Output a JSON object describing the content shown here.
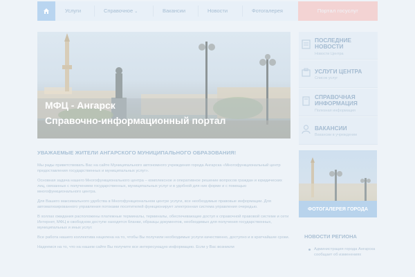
{
  "nav": {
    "items": [
      "Услуги",
      "Справочное",
      "Вакансии",
      "Новости",
      "Фотогалерея"
    ],
    "cta_label": "Портал госуслуг"
  },
  "hero": {
    "title": "МФЦ - Ангарск",
    "subtitle": "Справочно-информационный портал"
  },
  "sidebar": {
    "items": [
      {
        "title": "Последние новости",
        "sub": "Новости Центра"
      },
      {
        "title": "Услуги центра",
        "sub": "Список услуг"
      },
      {
        "title": "Справочная информация",
        "sub": "Полезная информация"
      },
      {
        "title": "Вакансии",
        "sub": "Вакансии в учреждении"
      }
    ],
    "gallery_caption": "ФОТОГАЛЕРЕЯ ГОРОДА",
    "news_title": "НОВОСТИ РЕГИОНА",
    "news_items": [
      "Администрация города Ангарска сообщает об изменениях"
    ]
  },
  "article": {
    "heading": "Уважаемые жители Ангарского муниципального образования!",
    "paragraphs": [
      "Мы рады приветствовать Вас на сайте Муниципального автономного учреждения города Ангарска «Многофункциональный центр предоставления государственных и муниципальных услуг».",
      "Основная задача нашего Многофункционального центра – комплексное и оперативное решение вопросов граждан и юридических лиц, связанных с получением государственных, муниципальных услуг и в удобной для них форме и с помощью многофункционального центра.",
      "Для Вашего максимального удобства в Многофункциональном центре услуги, все необходимые правовые информации. Для автоматизированного управления потоками посетителей функционирует электронная система управления очередью.",
      "В холлах ожидания расположены платежные терминалы, терминалы, обеспечивающие доступ к справочной правовой системе и сети Интернет, МФЦ в свободном доступе находятся бланки, образцы документов, необходимых для получения государственных, муниципальных и иных услуг.",
      "Все работа нашего коллектива нацелена на то, чтобы Вы получили необходимые услуги качественно, доступно и в кратчайшие сроки.",
      "Надеемся на то, что на нашем сайте Вы получите все интересующую информацию. Если у Вас возникли"
    ]
  },
  "colors": {
    "background": "#eef3f8",
    "accent": "#b9d5f0",
    "cta": "#f3d3d3"
  }
}
